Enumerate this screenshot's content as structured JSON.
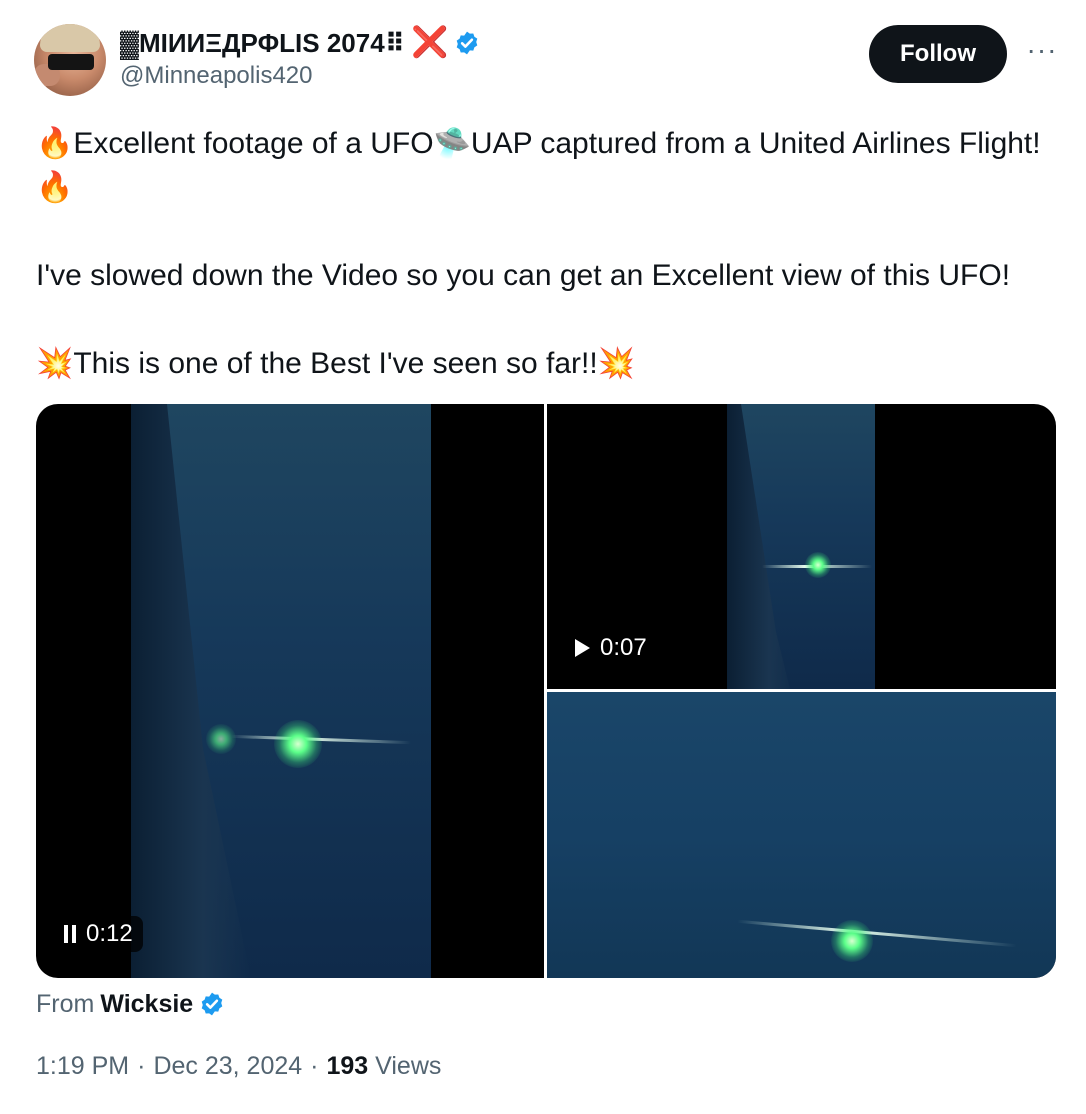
{
  "author": {
    "display_name": "▓МІИИΞДРΦLIS 2074⠿",
    "handle": "@Minneapolis420",
    "cross_mark": "❌",
    "verified_color": "#1d9bf0"
  },
  "actions": {
    "follow_label": "Follow",
    "more_label": "···"
  },
  "tweet": {
    "text": "🔥Excellent footage of a UFO🛸UAP captured from a United Airlines Flight!🔥\n\nI've slowed down the Video so you can get an Excellent view of this UFO!\n\n💥This is one of the Best I've seen so far!!💥"
  },
  "media": [
    {
      "state": "playing",
      "icon": "pause-icon",
      "duration": "0:12"
    },
    {
      "state": "paused",
      "icon": "play-icon",
      "duration": "0:07"
    },
    {
      "state": "preview",
      "icon": "",
      "duration": ""
    }
  ],
  "source": {
    "prefix": "From",
    "name": "Wicksie"
  },
  "footer": {
    "time": "1:19 PM",
    "separator": "·",
    "date": "Dec 23, 2024",
    "views_count": "193",
    "views_label": "Views"
  }
}
